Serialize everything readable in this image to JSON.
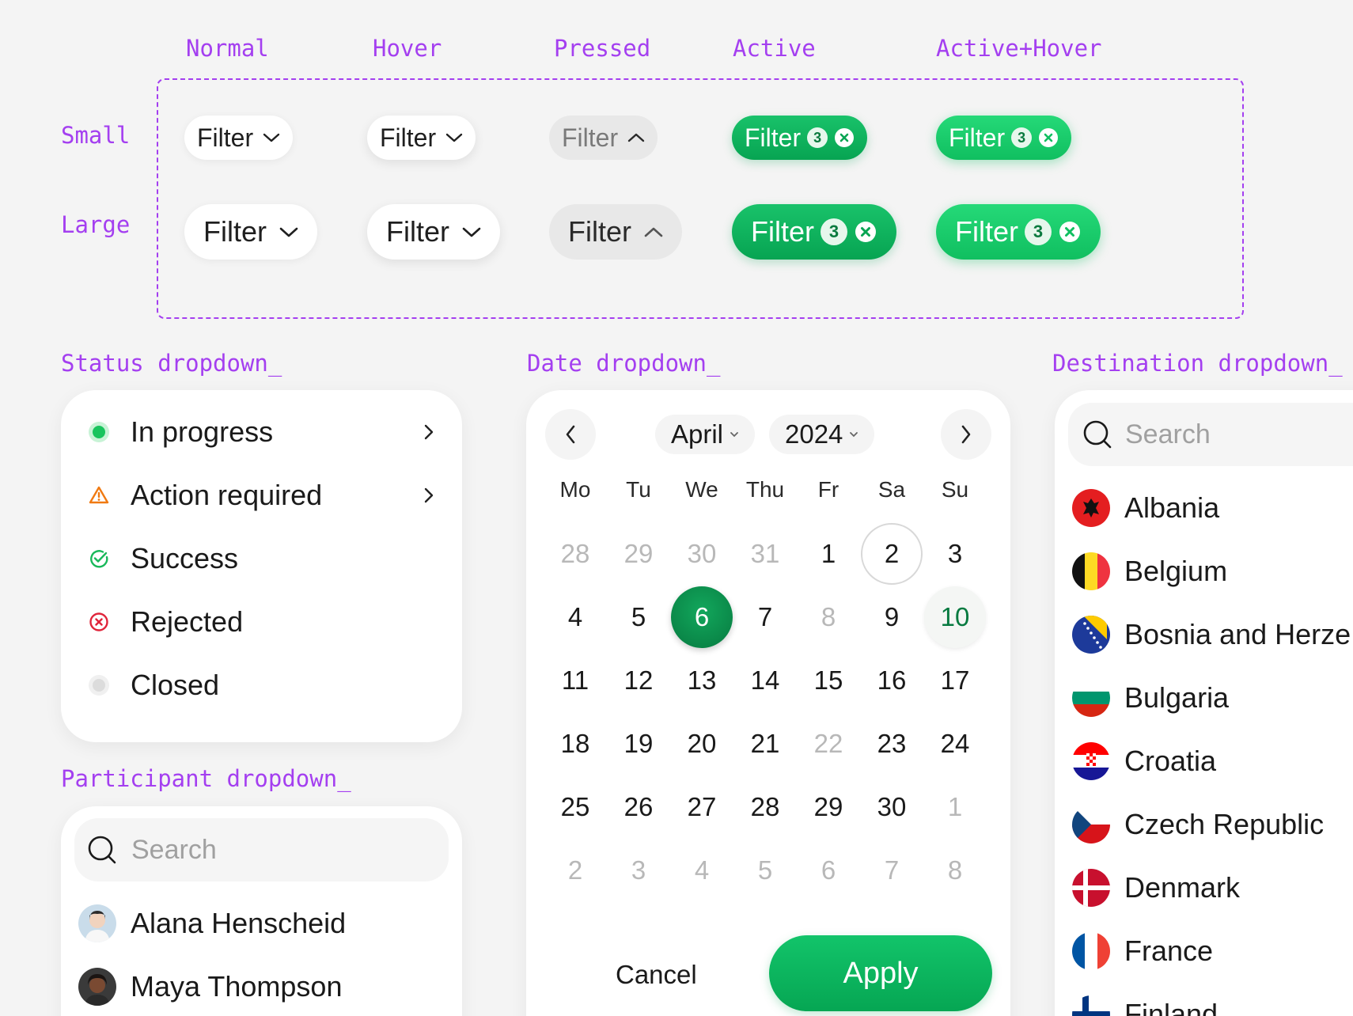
{
  "labels": {
    "states": [
      "Normal",
      "Hover",
      "Pressed",
      "Active",
      "Active+Hover"
    ],
    "sizes": [
      "Small",
      "Large"
    ],
    "status_section": "Status dropdown_",
    "date_section": "Date dropdown_",
    "destination_section": "Destination dropdown_",
    "participant_section": "Participant dropdown_"
  },
  "filter": {
    "label": "Filter",
    "count": "3"
  },
  "colors": {
    "accent_purple": "#a43ff0",
    "green": "#07a452",
    "green_dark": "#077a40"
  },
  "status": {
    "items": [
      {
        "label": "In progress",
        "icon": "green-dot-icon",
        "has_submenu": true
      },
      {
        "label": "Action required",
        "icon": "warning-icon",
        "has_submenu": true
      },
      {
        "label": "Success",
        "icon": "check-circle-icon",
        "has_submenu": false
      },
      {
        "label": "Rejected",
        "icon": "x-circle-icon",
        "has_submenu": false
      },
      {
        "label": "Closed",
        "icon": "grey-dot-icon",
        "has_submenu": false
      }
    ]
  },
  "participant": {
    "search_placeholder": "Search",
    "people": [
      "Alana Henscheid",
      "Maya Thompson"
    ]
  },
  "calendar": {
    "month": "April",
    "year": "2024",
    "weekdays": [
      "Mo",
      "Tu",
      "We",
      "Thu",
      "Fr",
      "Sa",
      "Su"
    ],
    "weeks": [
      [
        "28",
        "29",
        "30",
        "31",
        "1",
        "2",
        "3"
      ],
      [
        "4",
        "5",
        "6",
        "7",
        "8",
        "9",
        "10"
      ],
      [
        "11",
        "12",
        "13",
        "14",
        "15",
        "16",
        "17"
      ],
      [
        "18",
        "19",
        "20",
        "21",
        "22",
        "23",
        "24"
      ],
      [
        "25",
        "26",
        "27",
        "28",
        "29",
        "30",
        "1"
      ],
      [
        "2",
        "3",
        "4",
        "5",
        "6",
        "7",
        "8"
      ]
    ],
    "states": [
      [
        "muted",
        "muted",
        "muted",
        "muted",
        "",
        "outline",
        ""
      ],
      [
        "",
        "",
        "selected",
        "",
        "muted",
        "",
        "today"
      ],
      [
        "",
        "",
        "",
        "",
        "",
        "",
        ""
      ],
      [
        "",
        "",
        "",
        "",
        "muted",
        "",
        ""
      ],
      [
        "",
        "",
        "",
        "",
        "",
        "",
        "muted"
      ],
      [
        "muted",
        "muted",
        "muted",
        "muted",
        "muted",
        "muted",
        "muted"
      ]
    ],
    "cancel_label": "Cancel",
    "apply_label": "Apply"
  },
  "destination": {
    "search_placeholder": "Search",
    "countries": [
      "Albania",
      "Belgium",
      "Bosnia and Herze",
      "Bulgaria",
      "Croatia",
      "Czech Republic",
      "Denmark",
      "France",
      "Finland"
    ]
  }
}
